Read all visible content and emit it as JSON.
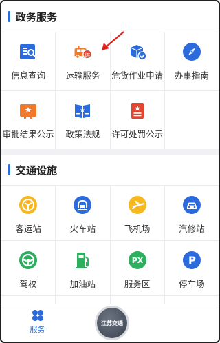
{
  "sections": {
    "gov": {
      "title": "政务服务"
    },
    "traffic": {
      "title": "交通设施"
    }
  },
  "gov_items": [
    {
      "label": "信息查询",
      "icon": "info-query-icon"
    },
    {
      "label": "运输服务",
      "icon": "transport-service-icon",
      "badge": "运"
    },
    {
      "label": "危货作业申请",
      "icon": "hazard-goods-icon"
    },
    {
      "label": "办事指南",
      "icon": "compass-icon"
    },
    {
      "label": "审批结果公示",
      "icon": "approval-result-icon"
    },
    {
      "label": "政策法规",
      "icon": "policy-icon"
    },
    {
      "label": "许可处罚公示",
      "icon": "permit-penalty-icon"
    }
  ],
  "traffic_items": [
    {
      "label": "客运站",
      "icon": "bus-station-icon"
    },
    {
      "label": "火车站",
      "icon": "train-station-icon"
    },
    {
      "label": "飞机场",
      "icon": "airport-icon"
    },
    {
      "label": "汽修站",
      "icon": "car-repair-icon"
    },
    {
      "label": "驾校",
      "icon": "steering-wheel-icon"
    },
    {
      "label": "加油站",
      "icon": "gas-station-icon"
    },
    {
      "label": "服务区",
      "icon": "service-area-icon",
      "badge": "PX"
    },
    {
      "label": "停车场",
      "icon": "parking-icon",
      "badge": "P"
    }
  ],
  "tabbar": {
    "service_label": "服务",
    "center_label": "江苏交通"
  },
  "colors": {
    "accent": "#2b6bdc",
    "orange": "#f07a2b",
    "red": "#e2452f",
    "yellow": "#f6b81f",
    "green": "#2daf5f"
  }
}
